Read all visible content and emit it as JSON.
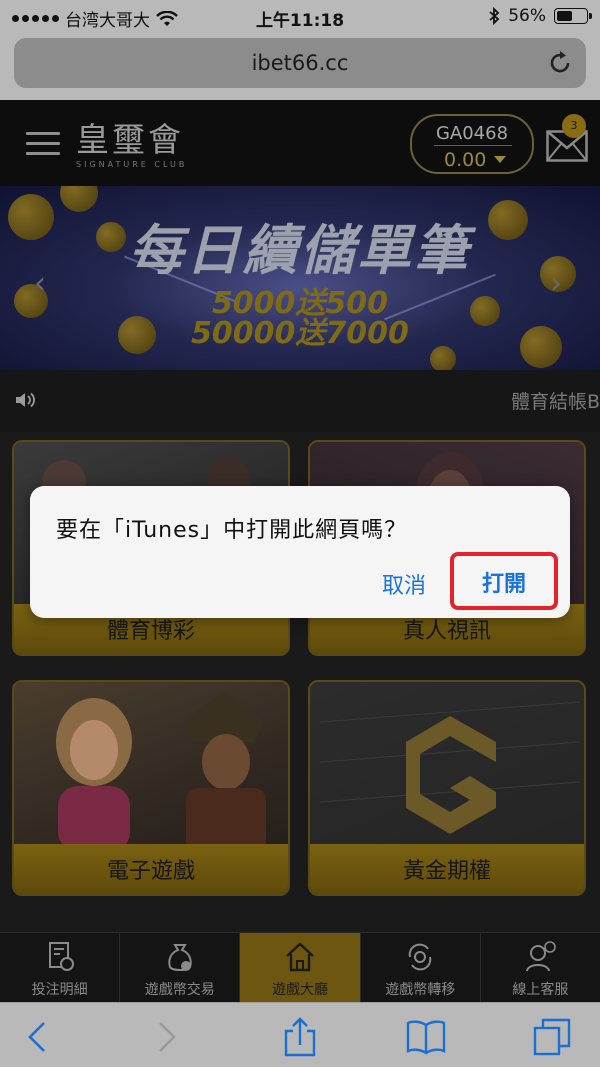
{
  "status_bar": {
    "carrier": "台湾大哥大",
    "time": "上午11:18",
    "battery": "56%",
    "battery_level": 0.56
  },
  "browser": {
    "url": "ibet66.cc"
  },
  "header": {
    "logo_title": "皇璽會",
    "logo_subtitle": "SIGNATURE CLUB",
    "account_id": "GA0468",
    "balance": "0.00",
    "mail_badge": "3"
  },
  "banner": {
    "title": "每日續儲單筆",
    "line1": "5000送500",
    "line2": "50000送7000"
  },
  "marquee": {
    "text": "體育結帳B"
  },
  "tiles": [
    {
      "label": "體育博彩"
    },
    {
      "label": "真人視訊"
    },
    {
      "label": "電子遊戲"
    },
    {
      "label": "黃金期權"
    }
  ],
  "tabbar": [
    {
      "label": "投注明細",
      "icon": "bet-record-icon"
    },
    {
      "label": "遊戲幣交易",
      "icon": "coin-bag-icon"
    },
    {
      "label": "遊戲大廳",
      "icon": "home-icon"
    },
    {
      "label": "遊戲幣轉移",
      "icon": "transfer-icon"
    },
    {
      "label": "線上客服",
      "icon": "customer-service-icon"
    }
  ],
  "dialog": {
    "message": "要在「iTunes」中打開此網頁嗎？",
    "cancel": "取消",
    "open": "打開"
  },
  "colors": {
    "accent_gold": "#9c8a3a",
    "ios_blue": "#1a73d9",
    "highlight_red": "#e5212a"
  }
}
